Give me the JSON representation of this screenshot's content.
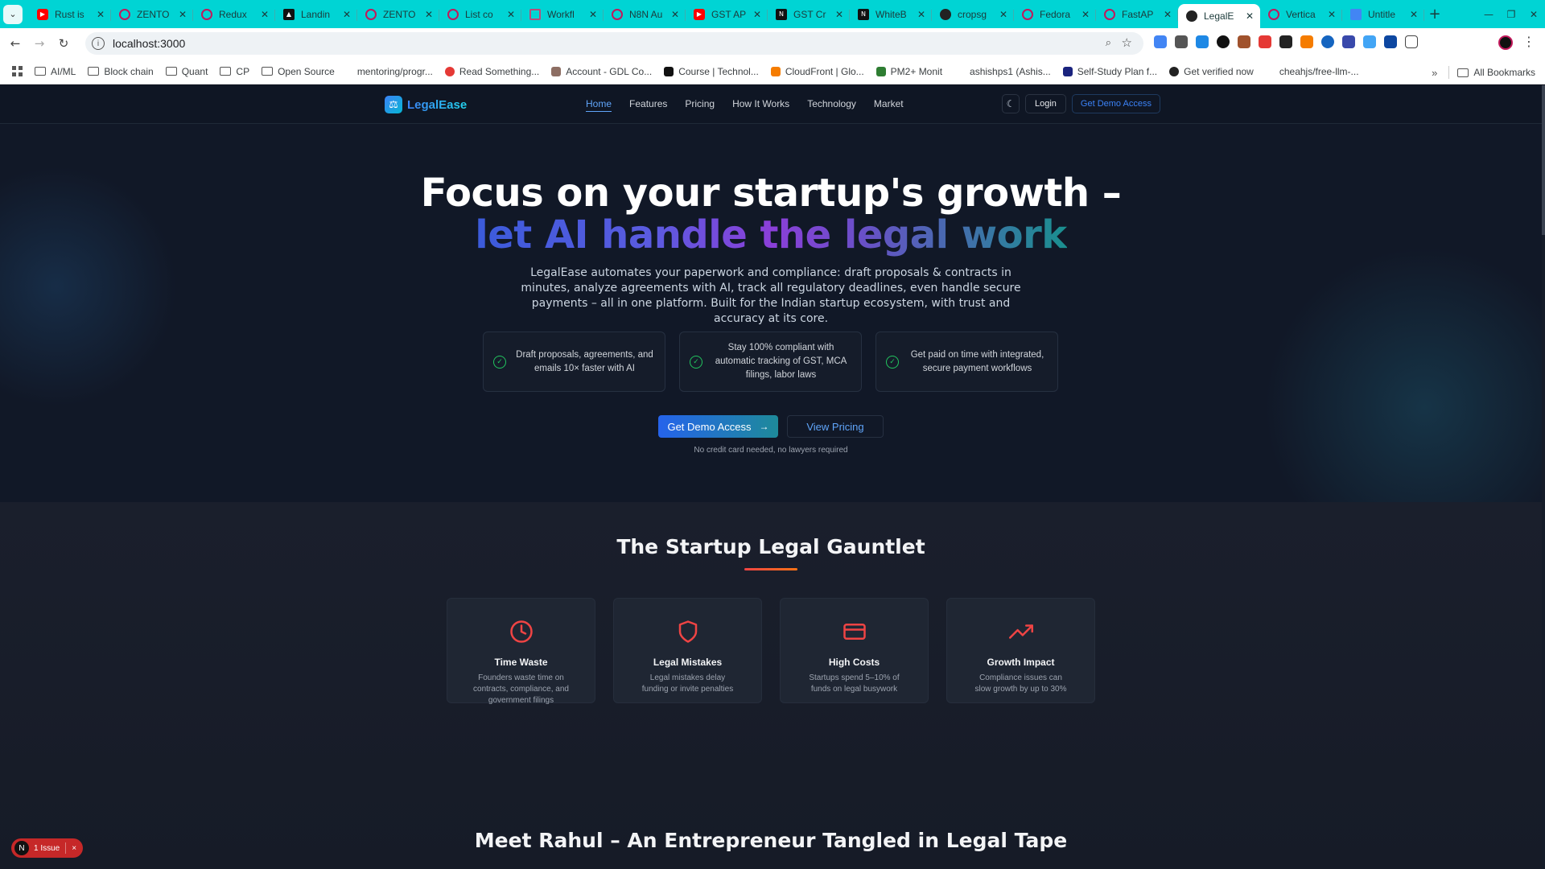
{
  "browser": {
    "tabs": [
      {
        "title": "Rust is",
        "icon": "youtube-icon"
      },
      {
        "title": "ZENTO",
        "icon": "chatgpt-icon"
      },
      {
        "title": "Redux",
        "icon": "chatgpt-icon"
      },
      {
        "title": "Landin",
        "icon": "vercel-icon"
      },
      {
        "title": "ZENTO",
        "icon": "chatgpt-icon"
      },
      {
        "title": "List co",
        "icon": "chatgpt-icon"
      },
      {
        "title": "Workfl",
        "icon": "n8n-icon"
      },
      {
        "title": "N8N Au",
        "icon": "chatgpt-icon"
      },
      {
        "title": "GST AP",
        "icon": "youtube-icon"
      },
      {
        "title": "GST Cr",
        "icon": "notion-icon"
      },
      {
        "title": "WhiteB",
        "icon": "notion-icon"
      },
      {
        "title": "cropsg",
        "icon": "github-icon"
      },
      {
        "title": "Fedora",
        "icon": "chatgpt-icon"
      },
      {
        "title": "FastAP",
        "icon": "chatgpt-icon"
      },
      {
        "title": "LegalE",
        "icon": "app-icon",
        "active": true
      },
      {
        "title": "Vertica",
        "icon": "chatgpt-icon"
      },
      {
        "title": "Untitle",
        "icon": "docs-icon"
      }
    ],
    "new_tab": "+",
    "url": "localhost:3000",
    "bookmarks": [
      {
        "label": "AI/ML",
        "type": "folder"
      },
      {
        "label": "Block chain",
        "type": "folder"
      },
      {
        "label": "Quant",
        "type": "folder"
      },
      {
        "label": "CP",
        "type": "folder"
      },
      {
        "label": "Open Source",
        "type": "folder"
      },
      {
        "label": "mentoring/progr...",
        "type": "link",
        "color": "#ffffff"
      },
      {
        "label": "Read Something...",
        "type": "link",
        "color": "#e53935"
      },
      {
        "label": "Account - GDL Co...",
        "type": "link",
        "color": "#8d6e63"
      },
      {
        "label": "Course | Technol...",
        "type": "link",
        "color": "#111111"
      },
      {
        "label": "CloudFront | Glo...",
        "type": "link",
        "color": "#f57c00"
      },
      {
        "label": "PM2+ Monit",
        "type": "link",
        "color": "#2e7d32"
      },
      {
        "label": "ashishps1 (Ashis...",
        "type": "link",
        "color": "#ffffff"
      },
      {
        "label": "Self-Study Plan f...",
        "type": "link",
        "color": "#1a237e"
      },
      {
        "label": "Get verified now",
        "type": "link",
        "color": "#222222"
      },
      {
        "label": "cheahjs/free-llm-...",
        "type": "link",
        "color": "#ffffff"
      }
    ],
    "more_bookmarks": "»",
    "all_bookmarks": "All Bookmarks"
  },
  "site": {
    "brand": "LegalEase",
    "nav": [
      "Home",
      "Features",
      "Pricing",
      "How It Works",
      "Technology",
      "Market"
    ],
    "login": "Login",
    "demo": "Get Demo Access"
  },
  "hero": {
    "line1": "Focus on your startup's growth –",
    "line2": "let AI handle the legal work",
    "subtitle": "LegalEase automates your paperwork and compliance: draft proposals & contracts in minutes, analyze agreements with AI, track all regulatory deadlines, even handle secure payments – all in one platform. Built for the Indian startup ecosystem, with trust and accuracy at its core.",
    "features": [
      "Draft proposals, agreements, and emails 10× faster with AI",
      "Stay 100% compliant with automatic tracking of GST, MCA filings, labor laws",
      "Get paid on time with integrated, secure payment workflows"
    ],
    "cta_primary": "Get Demo Access",
    "cta_secondary": "View Pricing",
    "note": "No credit card needed, no lawyers required"
  },
  "gauntlet": {
    "title": "The Startup Legal Gauntlet",
    "cards": [
      {
        "title": "Time Waste",
        "desc": "Founders waste time on contracts, compliance, and government filings",
        "icon": "clock-icon"
      },
      {
        "title": "Legal Mistakes",
        "desc": "Legal mistakes delay funding or invite penalties",
        "icon": "shield-icon"
      },
      {
        "title": "High Costs",
        "desc": "Startups spend 5–10% of funds on legal busywork",
        "icon": "credit-card-icon"
      },
      {
        "title": "Growth Impact",
        "desc": "Compliance issues can slow growth by up to 30%",
        "icon": "trending-up-icon"
      }
    ],
    "accent": "#ef4444"
  },
  "story": {
    "title": "Meet Rahul – An Entrepreneur Tangled in Legal Tape"
  },
  "dev_badge": {
    "logo": "N",
    "label": "1 Issue",
    "close": "×"
  }
}
